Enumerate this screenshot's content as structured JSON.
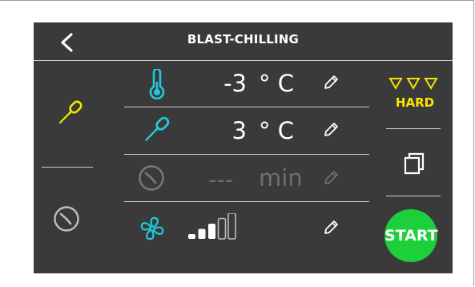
{
  "header": {
    "title": "BLAST-CHILLING",
    "back_icon": "chevron-left-icon"
  },
  "sidebar": {
    "probe_mode": {
      "icon": "probe-icon",
      "color": "#f2e400",
      "active": true
    },
    "timer_mode": {
      "icon": "clock-icon",
      "color": "#bdbdbd",
      "active": false
    }
  },
  "rows": {
    "air_temp": {
      "icon": "thermometer-icon",
      "value": "-3",
      "unit": "° C",
      "edit_icon": "pencil-icon",
      "enabled": true
    },
    "probe_temp": {
      "icon": "probe-icon",
      "value": "3",
      "unit": "° C",
      "edit_icon": "pencil-icon",
      "enabled": true
    },
    "time": {
      "icon": "clock-icon",
      "value": "---",
      "unit": "min",
      "edit_icon": "pencil-icon",
      "enabled": false
    },
    "fan": {
      "icon": "fan-icon",
      "level": 3,
      "max_level": 5,
      "edit_icon": "pencil-icon"
    }
  },
  "right_panel": {
    "mode_label": "HARD",
    "mode_icon": "triple-down-triangle-icon",
    "copy_icon": "copy-icon",
    "start_label": "START"
  },
  "colors": {
    "screen_bg": "#3a3a3a",
    "accent_cyan": "#22c8dc",
    "accent_yellow": "#f2e400",
    "start_green": "#1dcf3a",
    "disabled": "#6e6e6e"
  }
}
